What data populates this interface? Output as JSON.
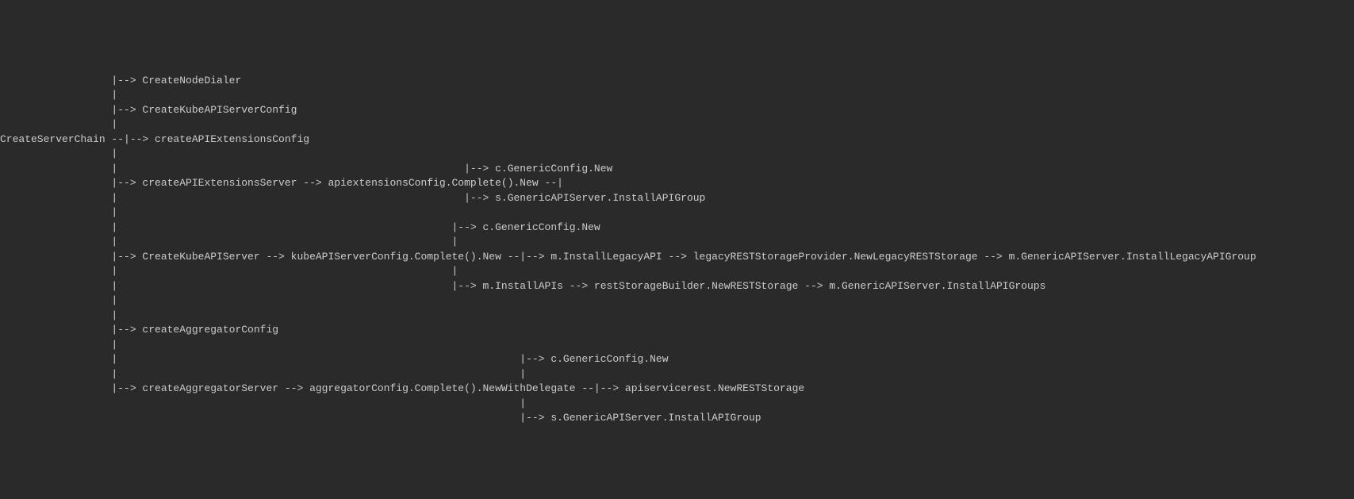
{
  "diagram": {
    "lines": [
      "                  |--> CreateNodeDialer",
      "                  |",
      "                  |--> CreateKubeAPIServerConfig",
      "                  |",
      "CreateServerChain --|--> createAPIExtensionsConfig",
      "                  |",
      "                  |                                                        |--> c.GenericConfig.New",
      "                  |--> createAPIExtensionsServer --> apiextensionsConfig.Complete().New --|",
      "                  |                                                        |--> s.GenericAPIServer.InstallAPIGroup",
      "                  |",
      "                  |                                                      |--> c.GenericConfig.New",
      "                  |                                                      |",
      "                  |--> CreateKubeAPIServer --> kubeAPIServerConfig.Complete().New --|--> m.InstallLegacyAPI --> legacyRESTStorageProvider.NewLegacyRESTStorage --> m.GenericAPIServer.InstallLegacyAPIGroup",
      "                  |                                                      |",
      "                  |                                                      |--> m.InstallAPIs --> restStorageBuilder.NewRESTStorage --> m.GenericAPIServer.InstallAPIGroups",
      "                  |",
      "                  |",
      "                  |--> createAggregatorConfig",
      "                  |",
      "                  |                                                                 |--> c.GenericConfig.New",
      "                  |                                                                 |",
      "                  |--> createAggregatorServer --> aggregatorConfig.Complete().NewWithDelegate --|--> apiservicerest.NewRESTStorage",
      "                                                                                    |",
      "                                                                                    |--> s.GenericAPIServer.InstallAPIGroup"
    ]
  }
}
